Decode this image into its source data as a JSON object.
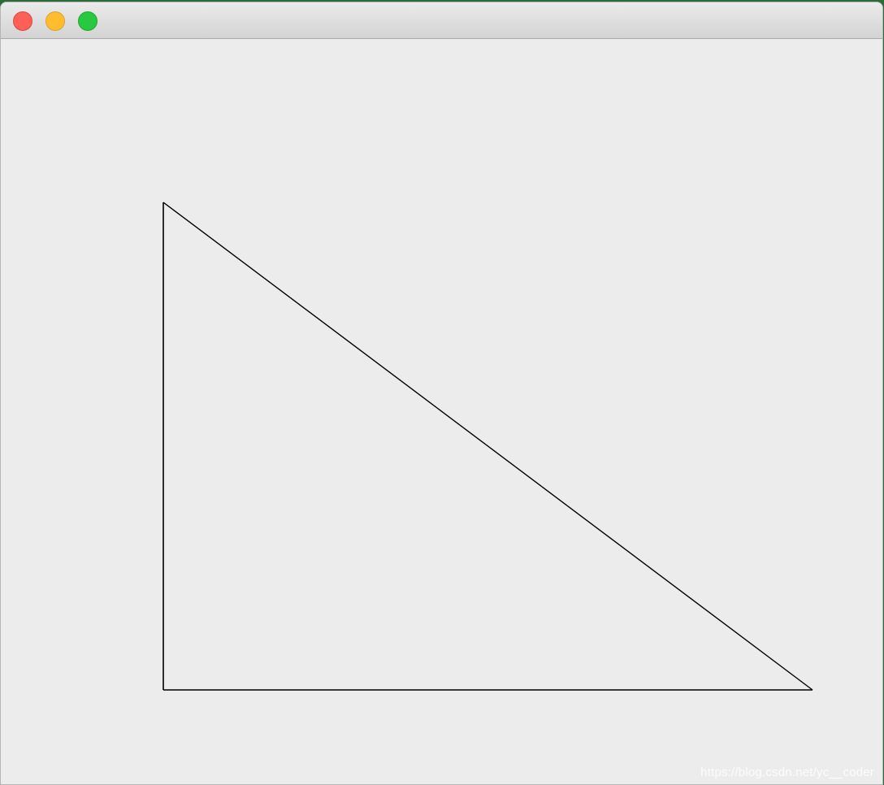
{
  "window": {
    "controls": {
      "close_color": "#fe5f57",
      "minimize_color": "#febc2e",
      "zoom_color": "#28c840"
    }
  },
  "canvas": {
    "background": "#ececec",
    "stroke": "#000000",
    "shape": "right-triangle"
  },
  "watermark": {
    "text": "https://blog.csdn.net/yc__coder"
  }
}
